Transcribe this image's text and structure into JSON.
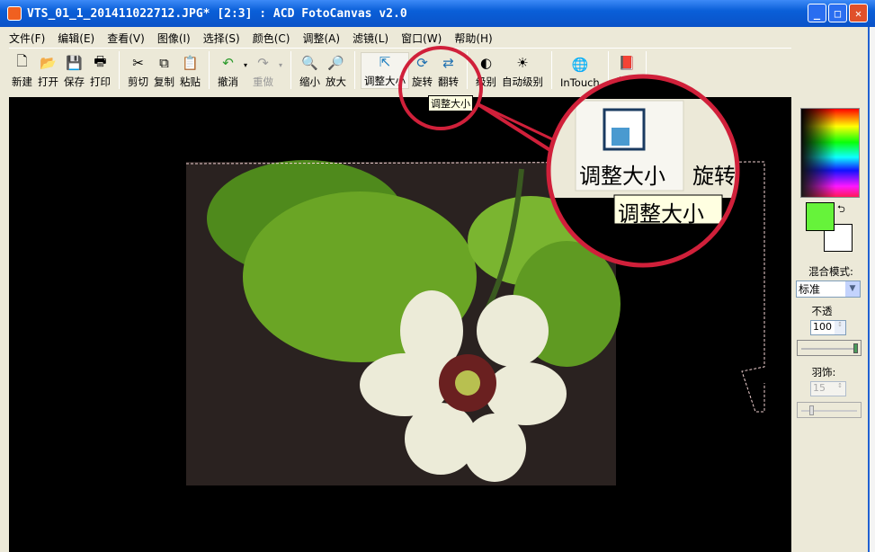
{
  "window": {
    "title": "VTS_01_1_201411022712.JPG* [2:3] : ACD FotoCanvas v2.0",
    "min": "_",
    "max": "□",
    "close": "✕"
  },
  "menu": [
    "文件(F)",
    "编辑(E)",
    "查看(V)",
    "图像(I)",
    "选择(S)",
    "颜色(C)",
    "调整(A)",
    "滤镜(L)",
    "窗口(W)",
    "帮助(H)"
  ],
  "toolbar": {
    "new": "新建",
    "open": "打开",
    "save": "保存",
    "print": "打印",
    "cut": "剪切",
    "copy": "复制",
    "paste": "粘贴",
    "undo": "撤消",
    "redo": "重做",
    "zoom_out": "缩小",
    "zoom_in": "放大",
    "resize": "调整大小",
    "rotate": "旋转",
    "flip": "翻转",
    "levels": "级别",
    "auto_levels": "自动级别",
    "intouch": "InTouch",
    "help": "帮助"
  },
  "tooltip": "调整大小",
  "callout": {
    "button_label": "调整大小",
    "next_label": "旋转",
    "tooltip": "调整大小"
  },
  "panel": {
    "fg_color": "#66f33a",
    "bg_color": "#ffffff",
    "blend_label": "混合模式:",
    "blend_value": "标准",
    "opacity_label": "不透",
    "opacity_value": "100",
    "opacity_percent": 100,
    "feather_label": "羽饰:",
    "feather_value": "15",
    "feather_percent": 15
  },
  "colors": {
    "highlight": "#d0203a"
  }
}
